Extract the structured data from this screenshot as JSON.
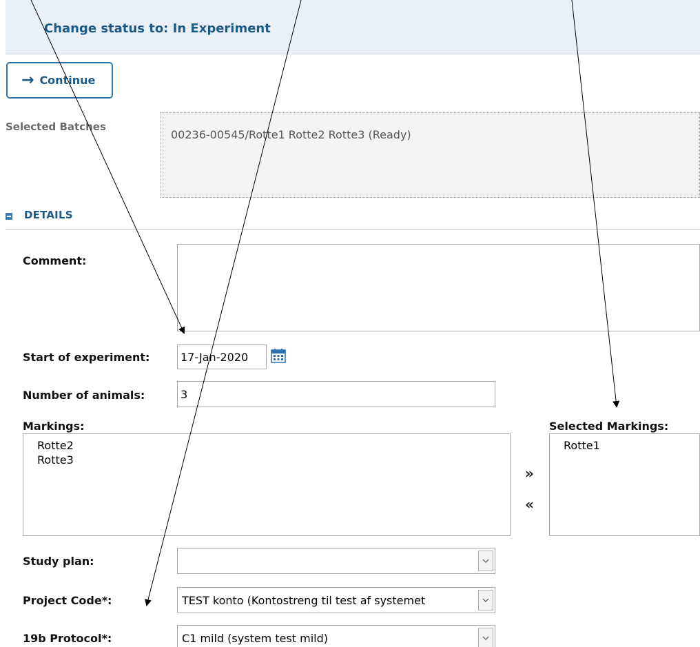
{
  "header": {
    "title": "Change status to: In Experiment"
  },
  "toolbar": {
    "continue_label": "Continue",
    "continue_icon": "arrow-right-icon"
  },
  "selected_batches": {
    "label": "Selected Batches",
    "value": "00236-00545/Rotte1 Rotte2 Rotte3 (Ready)"
  },
  "details": {
    "section_title": "DETAILS",
    "comment_label": "Comment:",
    "comment_value": "",
    "start_label": "Start of experiment:",
    "start_value": "17-Jan-2020",
    "number_label": "Number of animals:",
    "number_value": "3",
    "markings_label": "Markings:",
    "markings": [
      "Rotte2",
      "Rotte3"
    ],
    "selected_markings_label": "Selected Markings:",
    "selected_markings": [
      "Rotte1"
    ],
    "move_right": "»",
    "move_left": "«",
    "study_plan_label": "Study plan:",
    "study_plan_value": "",
    "project_code_label": "Project Code*:",
    "project_code_value": "TEST konto (Kontostreng til test af systemet",
    "protocol_label": "19b Protocol*:",
    "protocol_value": "C1 mild (system test mild)"
  }
}
